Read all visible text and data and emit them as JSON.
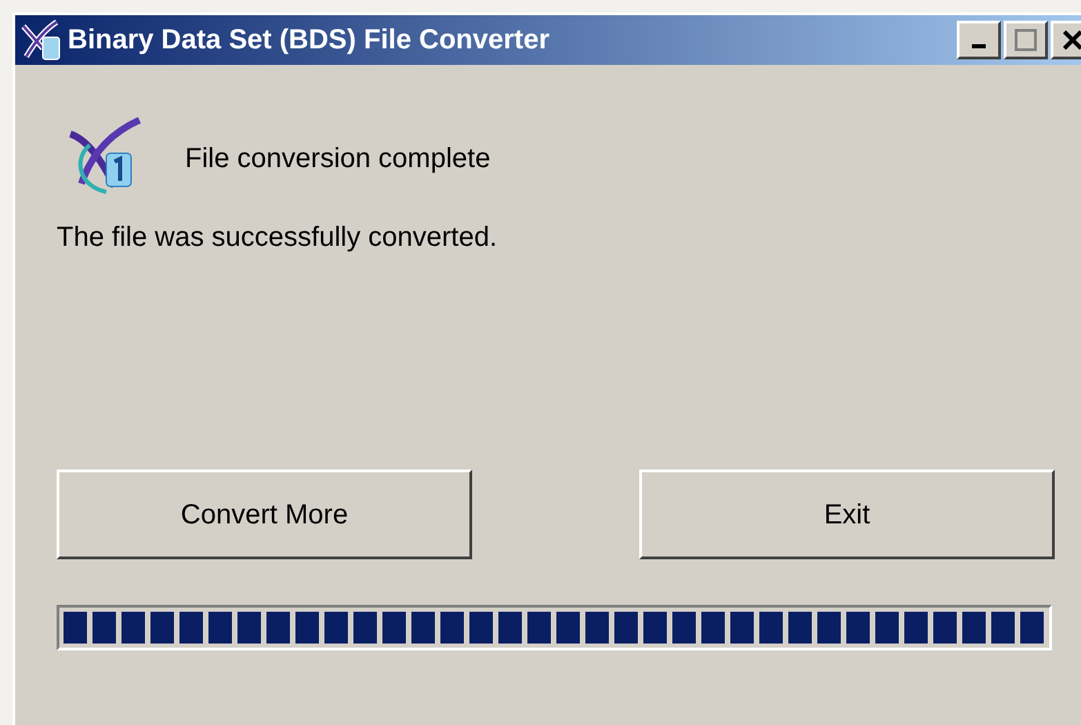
{
  "window": {
    "title": "Binary Data Set (BDS) File Converter"
  },
  "heading": "File conversion complete",
  "message": "The file was successfully converted.",
  "buttons": [
    "Convert More",
    "Exit"
  ],
  "progress": {
    "level": 1
  }
}
